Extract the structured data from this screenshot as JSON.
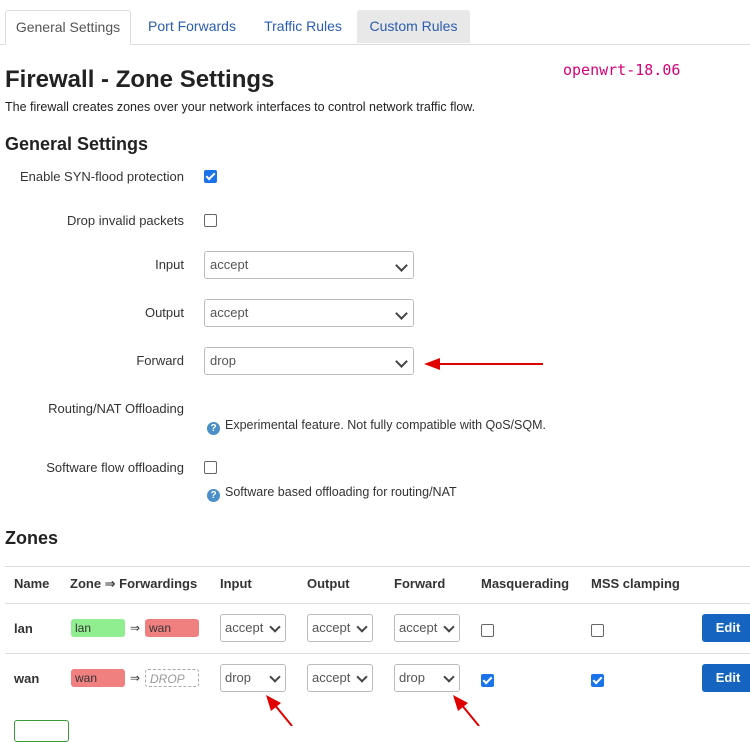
{
  "tabs": [
    {
      "label": "General Settings"
    },
    {
      "label": "Port Forwards"
    },
    {
      "label": "Traffic Rules"
    },
    {
      "label": "Custom Rules"
    }
  ],
  "page": {
    "title": "Firewall - Zone Settings",
    "version": "openwrt-18.06",
    "description": "The firewall creates zones over your network interfaces to control network traffic flow."
  },
  "general": {
    "heading": "General Settings",
    "syn_flood_label": "Enable SYN-flood protection",
    "syn_flood_checked": true,
    "drop_invalid_label": "Drop invalid packets",
    "drop_invalid_checked": false,
    "input_label": "Input",
    "input_value": "accept",
    "output_label": "Output",
    "output_value": "accept",
    "forward_label": "Forward",
    "forward_value": "drop",
    "nat_offload_label": "Routing/NAT Offloading",
    "nat_offload_help": "Experimental feature. Not fully compatible with QoS/SQM.",
    "sw_flow_label": "Software flow offloading",
    "sw_flow_checked": false,
    "sw_flow_help": "Software based offloading for routing/NAT"
  },
  "zones": {
    "heading": "Zones",
    "columns": [
      "Name",
      "Zone ⇒ Forwardings",
      "Input",
      "Output",
      "Forward",
      "Masquerading",
      "MSS clamping"
    ],
    "arrow": "⇒",
    "rows": [
      {
        "name": "lan",
        "zone": "lan",
        "forward_to": "wan",
        "input": "accept",
        "output": "accept",
        "forward": "accept",
        "masq": false,
        "mss": false,
        "edit": "Edit"
      },
      {
        "name": "wan",
        "zone": "wan",
        "forward_to": "DROP",
        "input": "drop",
        "output": "accept",
        "forward": "drop",
        "masq": true,
        "mss": true,
        "edit": "Edit"
      }
    ]
  },
  "colors": {
    "accent": "#1565c0",
    "lan": "#90ee90",
    "wan": "#f08080",
    "annotation": "#e00000"
  }
}
